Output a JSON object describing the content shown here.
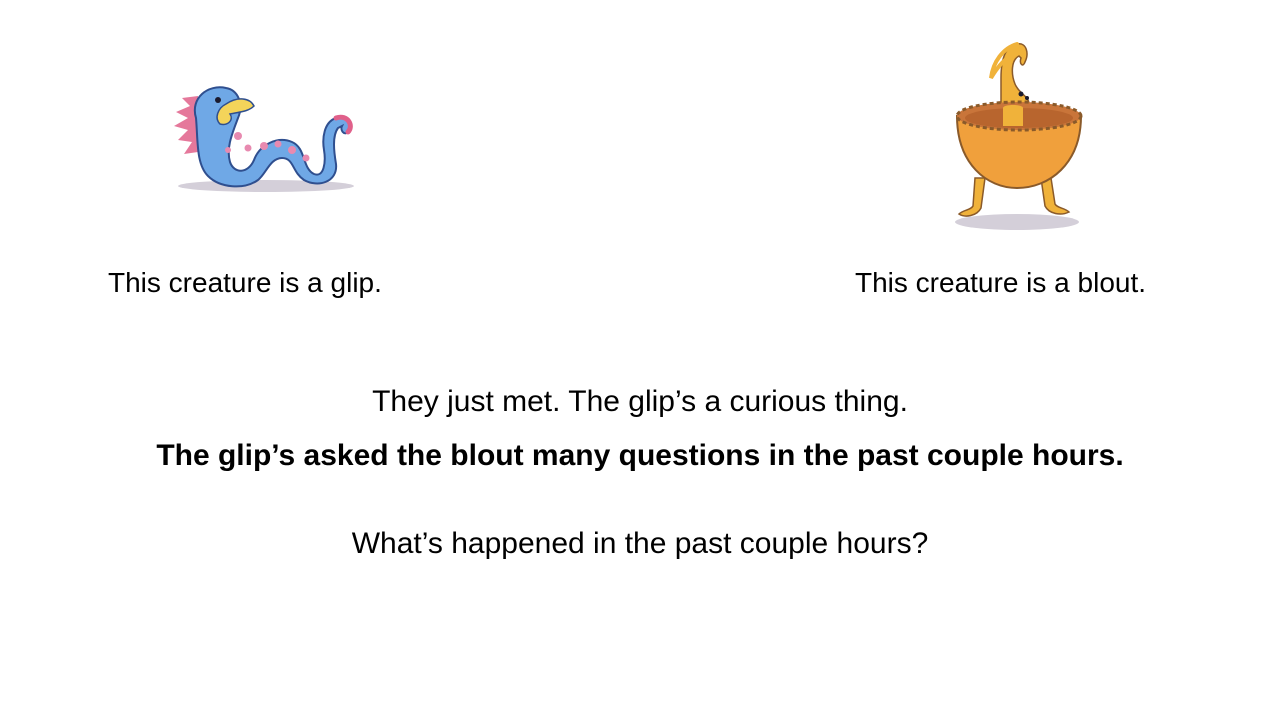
{
  "creatures": {
    "left": {
      "caption": "This creature is a glip.",
      "art_name": "glip",
      "colors": {
        "body": "#6fa8e6",
        "body_shade": "#3f6fc0",
        "beak": "#f4d45a",
        "spots": "#e88ab0",
        "crest": "#e0608a",
        "shadow": "#c9c3cf"
      }
    },
    "right": {
      "caption": "This creature is a blout.",
      "art_name": "blout",
      "colors": {
        "body": "#f0b23a",
        "bowl": "#f0a03c",
        "bowl_rim": "#8a5a2a",
        "bowl_inner": "#c9753a",
        "shadow": "#c9c3cf"
      }
    }
  },
  "text": {
    "line1": "They just met. The glip’s a curious thing.",
    "line2": "The glip’s asked the blout many questions in the past couple hours.",
    "line3": "What’s happened in the past couple hours?"
  }
}
